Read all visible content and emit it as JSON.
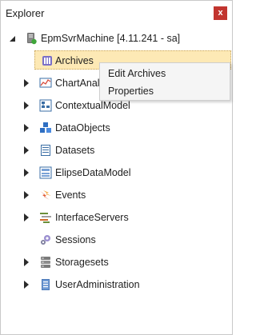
{
  "window": {
    "title": "Explorer",
    "close_glyph": "x",
    "accent_color": "#c2352f"
  },
  "tree": {
    "root": {
      "label": "EpmSvrMachine [4.11.241 - sa]",
      "icon": "server-icon",
      "expanded": true
    },
    "items": [
      {
        "label": "Archives",
        "icon": "archive-icon",
        "has_children": false,
        "selected": true
      },
      {
        "label": "ChartAnaly",
        "icon": "chart-icon",
        "has_children": true
      },
      {
        "label": "ContextualModel",
        "icon": "model-icon",
        "has_children": true
      },
      {
        "label": "DataObjects",
        "icon": "data-objects-icon",
        "has_children": true
      },
      {
        "label": "Datasets",
        "icon": "datasets-icon",
        "has_children": true
      },
      {
        "label": "ElipseDataModel",
        "icon": "data-model-icon",
        "has_children": true
      },
      {
        "label": "Events",
        "icon": "events-icon",
        "has_children": true
      },
      {
        "label": "InterfaceServers",
        "icon": "interface-servers-icon",
        "has_children": true
      },
      {
        "label": "Sessions",
        "icon": "sessions-icon",
        "has_children": false
      },
      {
        "label": "Storagesets",
        "icon": "storagesets-icon",
        "has_children": true
      },
      {
        "label": "UserAdministration",
        "icon": "user-admin-icon",
        "has_children": true
      }
    ]
  },
  "context_menu": {
    "items": [
      {
        "label": "Edit Archives"
      },
      {
        "label": "Properties"
      }
    ]
  },
  "colors": {
    "selection_fill": "#fde9b5",
    "selection_border": "#c9a55a"
  }
}
